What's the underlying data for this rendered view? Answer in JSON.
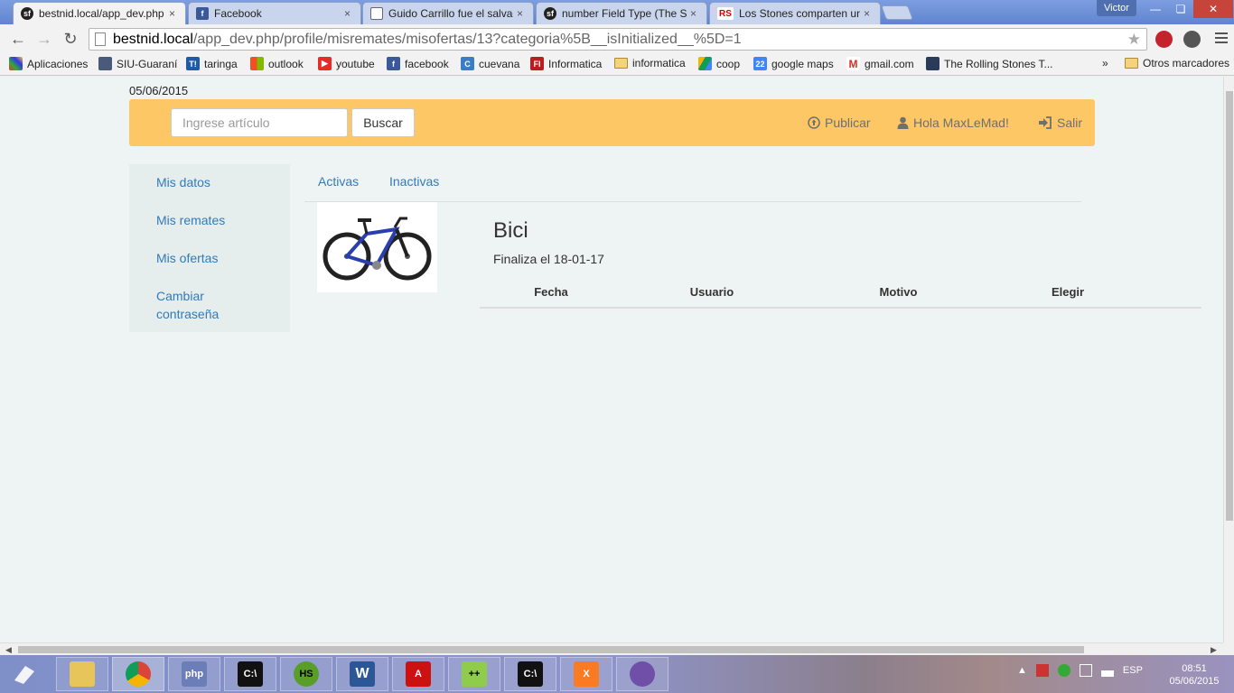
{
  "browser": {
    "tabs": [
      {
        "title": "bestnid.local/app_dev.php",
        "icon": "symfony-icon",
        "active": true
      },
      {
        "title": "Facebook",
        "icon": "facebook-icon",
        "active": false
      },
      {
        "title": "Guido Carrillo fue el salvad",
        "icon": "page-icon",
        "active": false
      },
      {
        "title": "number Field Type (The Sy",
        "icon": "symfony-icon",
        "active": false
      },
      {
        "title": "Los Stones comparten una",
        "icon": "rs-icon",
        "active": false
      }
    ],
    "tab_close": "×",
    "user": "Victor",
    "url_host": "bestnid.local",
    "url_path": "/app_dev.php/profile/misremates/misofertas/13?categoria%5B__isInitialized__%5D=1"
  },
  "bookmarks": {
    "items": [
      {
        "label": "Aplicaciones",
        "icon": "apps-grid-icon"
      },
      {
        "label": "SIU-Guaraní",
        "icon": "siu-icon"
      },
      {
        "label": "taringa",
        "icon": "taringa-icon"
      },
      {
        "label": "outlook",
        "icon": "windows-icon"
      },
      {
        "label": "youtube",
        "icon": "youtube-icon"
      },
      {
        "label": "facebook",
        "icon": "facebook-icon"
      },
      {
        "label": "cuevana",
        "icon": "cuevana-icon"
      },
      {
        "label": "Informatica",
        "icon": "fi-icon"
      },
      {
        "label": "informatica",
        "icon": "folder-icon"
      },
      {
        "label": "coop",
        "icon": "drive-icon"
      },
      {
        "label": "google maps",
        "icon": "calendar-icon"
      },
      {
        "label": "gmail.com",
        "icon": "gmail-icon"
      },
      {
        "label": "The Rolling Stones T...",
        "icon": "rolling-stones-icon"
      }
    ],
    "more": "»",
    "other": "Otros marcadores"
  },
  "page": {
    "date": "05/06/2015",
    "search_placeholder": "Ingrese artículo",
    "search_button": "Buscar",
    "publish": "Publicar",
    "greeting": "Hola MaxLeMad!",
    "logout": "Salir",
    "sidebar": [
      "Mis datos",
      "Mis remates",
      "Mis ofertas",
      "Cambiar contraseña"
    ],
    "tabs": [
      "Activas",
      "Inactivas"
    ],
    "item": {
      "title": "Bici",
      "ends": "Finaliza el 18-01-17"
    },
    "table_headers": [
      "Fecha",
      "Usuario",
      "Motivo",
      "Elegir"
    ]
  },
  "taskbar": {
    "lang": "ESP",
    "time": "08:51",
    "date": "05/06/2015"
  },
  "colors": {
    "navbar": "#fdc765",
    "link": "#337ab7",
    "background": "#eef4f3"
  }
}
